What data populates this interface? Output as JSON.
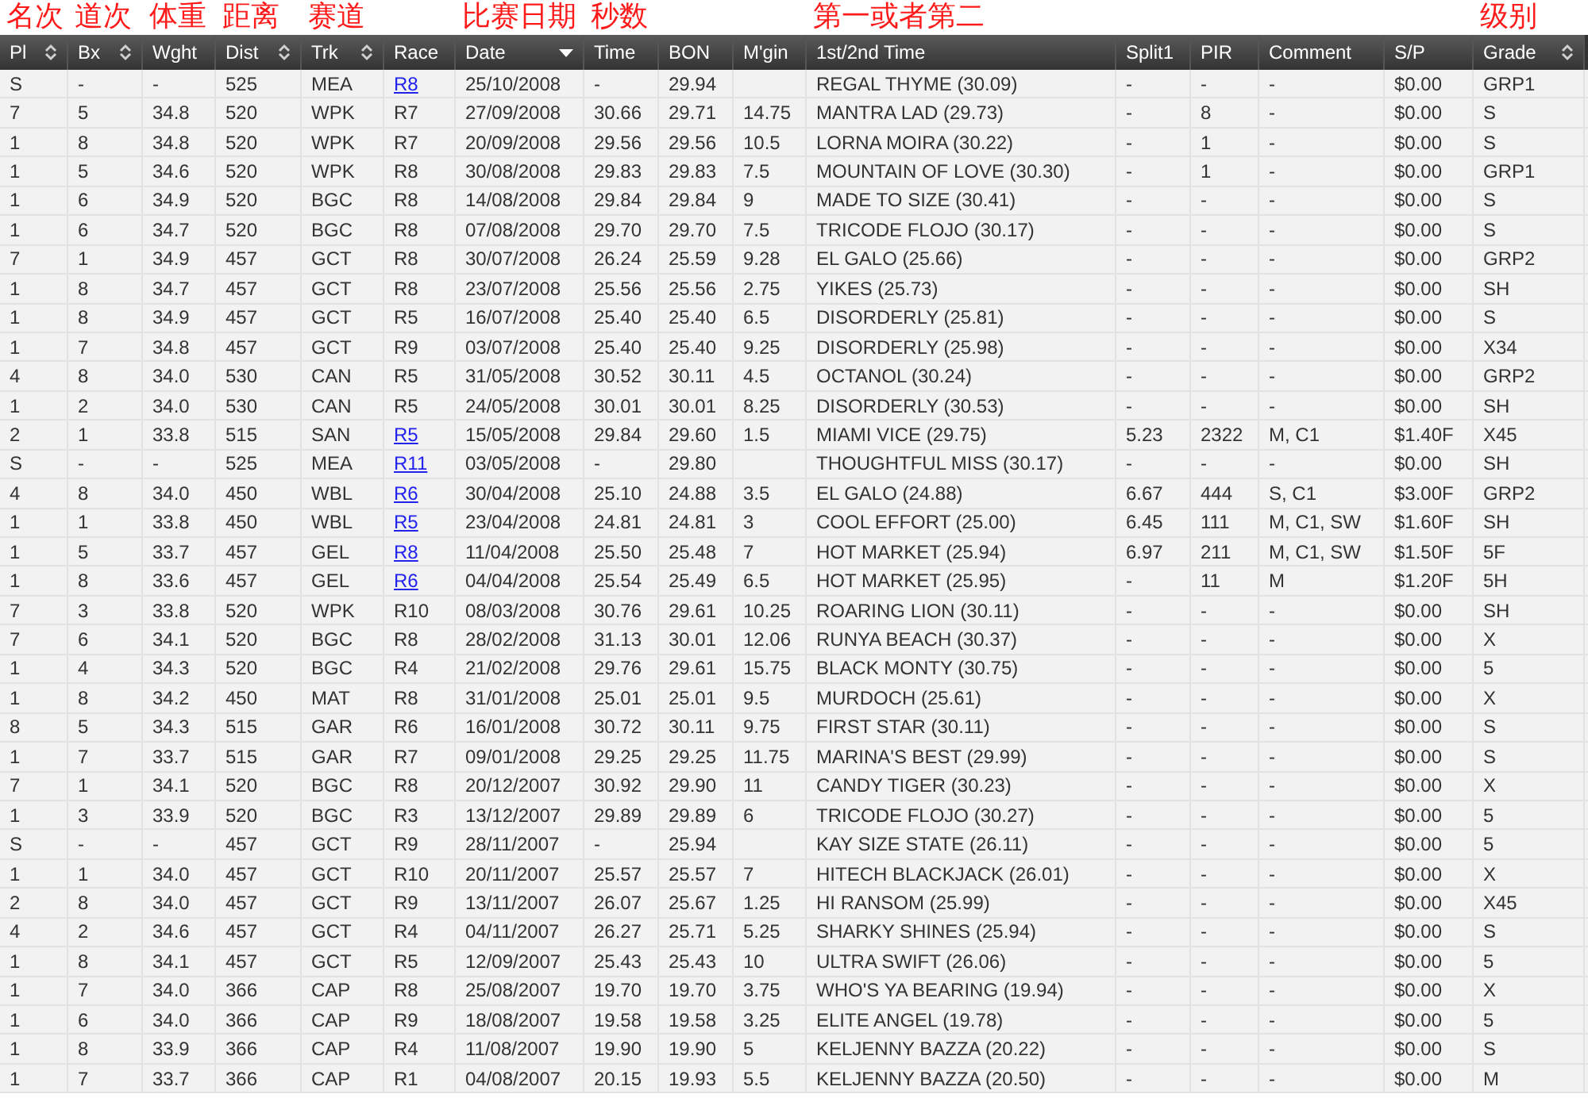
{
  "columns": [
    {
      "label": "Pl",
      "sortable": true,
      "sorted": false,
      "note": "名次"
    },
    {
      "label": "Bx",
      "sortable": true,
      "sorted": false,
      "note": "道次"
    },
    {
      "label": "Wght",
      "sortable": false,
      "sorted": false,
      "note": "体重"
    },
    {
      "label": "Dist",
      "sortable": true,
      "sorted": false,
      "note": "距离"
    },
    {
      "label": "Trk",
      "sortable": true,
      "sorted": false,
      "note": "赛道"
    },
    {
      "label": "Race",
      "sortable": false,
      "sorted": false
    },
    {
      "label": "Date",
      "sortable": true,
      "sorted": true,
      "note": "比赛日期"
    },
    {
      "label": "Time",
      "sortable": false,
      "sorted": false,
      "note": "秒数"
    },
    {
      "label": "BON",
      "sortable": false,
      "sorted": false
    },
    {
      "label": "M'gin",
      "sortable": false,
      "sorted": false
    },
    {
      "label": "1st/2nd Time",
      "sortable": false,
      "sorted": false,
      "note": "第一或者第二"
    },
    {
      "label": "Split1",
      "sortable": false,
      "sorted": false
    },
    {
      "label": "PIR",
      "sortable": false,
      "sorted": false
    },
    {
      "label": "Comment",
      "sortable": false,
      "sorted": false
    },
    {
      "label": "S/P",
      "sortable": false,
      "sorted": false
    },
    {
      "label": "Grade",
      "sortable": true,
      "sorted": false,
      "note": "级别"
    }
  ],
  "rows": [
    {
      "race_link": true,
      "cells": [
        "S",
        "-",
        "-",
        "525",
        "MEA",
        "R8",
        "25/10/2008",
        "-",
        "29.94",
        "",
        "REGAL THYME (30.09)",
        "-",
        "-",
        "-",
        "$0.00",
        "GRP1"
      ]
    },
    {
      "race_link": false,
      "cells": [
        "7",
        "5",
        "34.8",
        "520",
        "WPK",
        "R7",
        "27/09/2008",
        "30.66",
        "29.71",
        "14.75",
        "MANTRA LAD (29.73)",
        "-",
        "8",
        "-",
        "$0.00",
        "S"
      ]
    },
    {
      "race_link": false,
      "cells": [
        "1",
        "8",
        "34.8",
        "520",
        "WPK",
        "R7",
        "20/09/2008",
        "29.56",
        "29.56",
        "10.5",
        "LORNA MOIRA (30.22)",
        "-",
        "1",
        "-",
        "$0.00",
        "S"
      ]
    },
    {
      "race_link": false,
      "cells": [
        "1",
        "5",
        "34.6",
        "520",
        "WPK",
        "R8",
        "30/08/2008",
        "29.83",
        "29.83",
        "7.5",
        "MOUNTAIN OF LOVE (30.30)",
        "-",
        "1",
        "-",
        "$0.00",
        "GRP1"
      ]
    },
    {
      "race_link": false,
      "cells": [
        "1",
        "6",
        "34.9",
        "520",
        "BGC",
        "R8",
        "14/08/2008",
        "29.84",
        "29.84",
        "9",
        "MADE TO SIZE (30.41)",
        "-",
        "-",
        "-",
        "$0.00",
        "S"
      ]
    },
    {
      "race_link": false,
      "cells": [
        "1",
        "6",
        "34.7",
        "520",
        "BGC",
        "R8",
        "07/08/2008",
        "29.70",
        "29.70",
        "7.5",
        "TRICODE FLOJO (30.17)",
        "-",
        "-",
        "-",
        "$0.00",
        "S"
      ]
    },
    {
      "race_link": false,
      "cells": [
        "7",
        "1",
        "34.9",
        "457",
        "GCT",
        "R8",
        "30/07/2008",
        "26.24",
        "25.59",
        "9.28",
        "EL GALO (25.66)",
        "-",
        "-",
        "-",
        "$0.00",
        "GRP2"
      ]
    },
    {
      "race_link": false,
      "cells": [
        "1",
        "8",
        "34.7",
        "457",
        "GCT",
        "R8",
        "23/07/2008",
        "25.56",
        "25.56",
        "2.75",
        "YIKES (25.73)",
        "-",
        "-",
        "-",
        "$0.00",
        "SH"
      ]
    },
    {
      "race_link": false,
      "cells": [
        "1",
        "8",
        "34.9",
        "457",
        "GCT",
        "R5",
        "16/07/2008",
        "25.40",
        "25.40",
        "6.5",
        "DISORDERLY (25.81)",
        "-",
        "-",
        "-",
        "$0.00",
        "S"
      ]
    },
    {
      "race_link": false,
      "cells": [
        "1",
        "7",
        "34.8",
        "457",
        "GCT",
        "R9",
        "03/07/2008",
        "25.40",
        "25.40",
        "9.25",
        "DISORDERLY (25.98)",
        "-",
        "-",
        "-",
        "$0.00",
        "X34"
      ]
    },
    {
      "race_link": false,
      "cells": [
        "4",
        "8",
        "34.0",
        "530",
        "CAN",
        "R5",
        "31/05/2008",
        "30.52",
        "30.11",
        "4.5",
        "OCTANOL (30.24)",
        "-",
        "-",
        "-",
        "$0.00",
        "GRP2"
      ]
    },
    {
      "race_link": false,
      "cells": [
        "1",
        "2",
        "34.0",
        "530",
        "CAN",
        "R5",
        "24/05/2008",
        "30.01",
        "30.01",
        "8.25",
        "DISORDERLY (30.53)",
        "-",
        "-",
        "-",
        "$0.00",
        "SH"
      ]
    },
    {
      "race_link": true,
      "cells": [
        "2",
        "1",
        "33.8",
        "515",
        "SAN",
        "R5",
        "15/05/2008",
        "29.84",
        "29.60",
        "1.5",
        "MIAMI VICE (29.75)",
        "5.23",
        "2322",
        "M, C1",
        "$1.40F",
        "X45"
      ]
    },
    {
      "race_link": true,
      "cells": [
        "S",
        "-",
        "-",
        "525",
        "MEA",
        "R11",
        "03/05/2008",
        "-",
        "29.80",
        "",
        "THOUGHTFUL MISS (30.17)",
        "-",
        "-",
        "-",
        "$0.00",
        "SH"
      ]
    },
    {
      "race_link": true,
      "cells": [
        "4",
        "8",
        "34.0",
        "450",
        "WBL",
        "R6",
        "30/04/2008",
        "25.10",
        "24.88",
        "3.5",
        "EL GALO (24.88)",
        "6.67",
        "444",
        "S, C1",
        "$3.00F",
        "GRP2"
      ]
    },
    {
      "race_link": true,
      "cells": [
        "1",
        "1",
        "33.8",
        "450",
        "WBL",
        "R5",
        "23/04/2008",
        "24.81",
        "24.81",
        "3",
        "COOL EFFORT (25.00)",
        "6.45",
        "111",
        "M, C1, SW",
        "$1.60F",
        "SH"
      ]
    },
    {
      "race_link": true,
      "cells": [
        "1",
        "5",
        "33.7",
        "457",
        "GEL",
        "R8",
        "11/04/2008",
        "25.50",
        "25.48",
        "7",
        "HOT MARKET (25.94)",
        "6.97",
        "211",
        "M, C1, SW",
        "$1.50F",
        "5F"
      ]
    },
    {
      "race_link": true,
      "cells": [
        "1",
        "8",
        "33.6",
        "457",
        "GEL",
        "R6",
        "04/04/2008",
        "25.54",
        "25.49",
        "6.5",
        "HOT MARKET (25.95)",
        "-",
        "11",
        "M",
        "$1.20F",
        "5H"
      ]
    },
    {
      "race_link": false,
      "cells": [
        "7",
        "3",
        "33.8",
        "520",
        "WPK",
        "R10",
        "08/03/2008",
        "30.76",
        "29.61",
        "10.25",
        "ROARING LION (30.11)",
        "-",
        "-",
        "-",
        "$0.00",
        "SH"
      ]
    },
    {
      "race_link": false,
      "cells": [
        "7",
        "6",
        "34.1",
        "520",
        "BGC",
        "R8",
        "28/02/2008",
        "31.13",
        "30.01",
        "12.06",
        "RUNYA BEACH (30.37)",
        "-",
        "-",
        "-",
        "$0.00",
        "X"
      ]
    },
    {
      "race_link": false,
      "cells": [
        "1",
        "4",
        "34.3",
        "520",
        "BGC",
        "R4",
        "21/02/2008",
        "29.76",
        "29.61",
        "15.75",
        "BLACK MONTY (30.75)",
        "-",
        "-",
        "-",
        "$0.00",
        "5"
      ]
    },
    {
      "race_link": false,
      "cells": [
        "1",
        "8",
        "34.2",
        "450",
        "MAT",
        "R8",
        "31/01/2008",
        "25.01",
        "25.01",
        "9.5",
        "MURDOCH (25.61)",
        "-",
        "-",
        "-",
        "$0.00",
        "X"
      ]
    },
    {
      "race_link": false,
      "cells": [
        "8",
        "5",
        "34.3",
        "515",
        "GAR",
        "R6",
        "16/01/2008",
        "30.72",
        "30.11",
        "9.75",
        "FIRST STAR (30.11)",
        "-",
        "-",
        "-",
        "$0.00",
        "S"
      ]
    },
    {
      "race_link": false,
      "cells": [
        "1",
        "7",
        "33.7",
        "515",
        "GAR",
        "R7",
        "09/01/2008",
        "29.25",
        "29.25",
        "11.75",
        "MARINA'S BEST (29.99)",
        "-",
        "-",
        "-",
        "$0.00",
        "S"
      ]
    },
    {
      "race_link": false,
      "cells": [
        "7",
        "1",
        "34.1",
        "520",
        "BGC",
        "R8",
        "20/12/2007",
        "30.92",
        "29.90",
        "11",
        "CANDY TIGER (30.23)",
        "-",
        "-",
        "-",
        "$0.00",
        "X"
      ]
    },
    {
      "race_link": false,
      "cells": [
        "1",
        "3",
        "33.9",
        "520",
        "BGC",
        "R3",
        "13/12/2007",
        "29.89",
        "29.89",
        "6",
        "TRICODE FLOJO (30.27)",
        "-",
        "-",
        "-",
        "$0.00",
        "5"
      ]
    },
    {
      "race_link": false,
      "cells": [
        "S",
        "-",
        "-",
        "457",
        "GCT",
        "R9",
        "28/11/2007",
        "-",
        "25.94",
        "",
        "KAY SIZE STATE (26.11)",
        "-",
        "-",
        "-",
        "$0.00",
        "5"
      ]
    },
    {
      "race_link": false,
      "cells": [
        "1",
        "1",
        "34.0",
        "457",
        "GCT",
        "R10",
        "20/11/2007",
        "25.57",
        "25.57",
        "7",
        "HITECH BLACKJACK (26.01)",
        "-",
        "-",
        "-",
        "$0.00",
        "X"
      ]
    },
    {
      "race_link": false,
      "cells": [
        "2",
        "8",
        "34.0",
        "457",
        "GCT",
        "R9",
        "13/11/2007",
        "26.07",
        "25.67",
        "1.25",
        "HI RANSOM (25.99)",
        "-",
        "-",
        "-",
        "$0.00",
        "X45"
      ]
    },
    {
      "race_link": false,
      "cells": [
        "4",
        "2",
        "34.6",
        "457",
        "GCT",
        "R4",
        "04/11/2007",
        "26.27",
        "25.71",
        "5.25",
        "SHARKY SHINES (25.94)",
        "-",
        "-",
        "-",
        "$0.00",
        "S"
      ]
    },
    {
      "race_link": false,
      "cells": [
        "1",
        "8",
        "34.1",
        "457",
        "GCT",
        "R5",
        "12/09/2007",
        "25.43",
        "25.43",
        "10",
        "ULTRA SWIFT (26.06)",
        "-",
        "-",
        "-",
        "$0.00",
        "5"
      ]
    },
    {
      "race_link": false,
      "cells": [
        "1",
        "7",
        "34.0",
        "366",
        "CAP",
        "R8",
        "25/08/2007",
        "19.70",
        "19.70",
        "3.75",
        "WHO'S YA BEARING (19.94)",
        "-",
        "-",
        "-",
        "$0.00",
        "X"
      ]
    },
    {
      "race_link": false,
      "cells": [
        "1",
        "6",
        "34.0",
        "366",
        "CAP",
        "R9",
        "18/08/2007",
        "19.58",
        "19.58",
        "3.25",
        "ELITE ANGEL (19.78)",
        "-",
        "-",
        "-",
        "$0.00",
        "5"
      ]
    },
    {
      "race_link": false,
      "cells": [
        "1",
        "8",
        "33.9",
        "366",
        "CAP",
        "R4",
        "11/08/2007",
        "19.90",
        "19.90",
        "5",
        "KELJENNY BAZZA (20.22)",
        "-",
        "-",
        "-",
        "$0.00",
        "S"
      ]
    },
    {
      "race_link": false,
      "cells": [
        "1",
        "7",
        "33.7",
        "366",
        "CAP",
        "R1",
        "04/08/2007",
        "20.15",
        "19.93",
        "5.5",
        "KELJENNY BAZZA (20.50)",
        "-",
        "-",
        "-",
        "$0.00",
        "M"
      ]
    }
  ]
}
